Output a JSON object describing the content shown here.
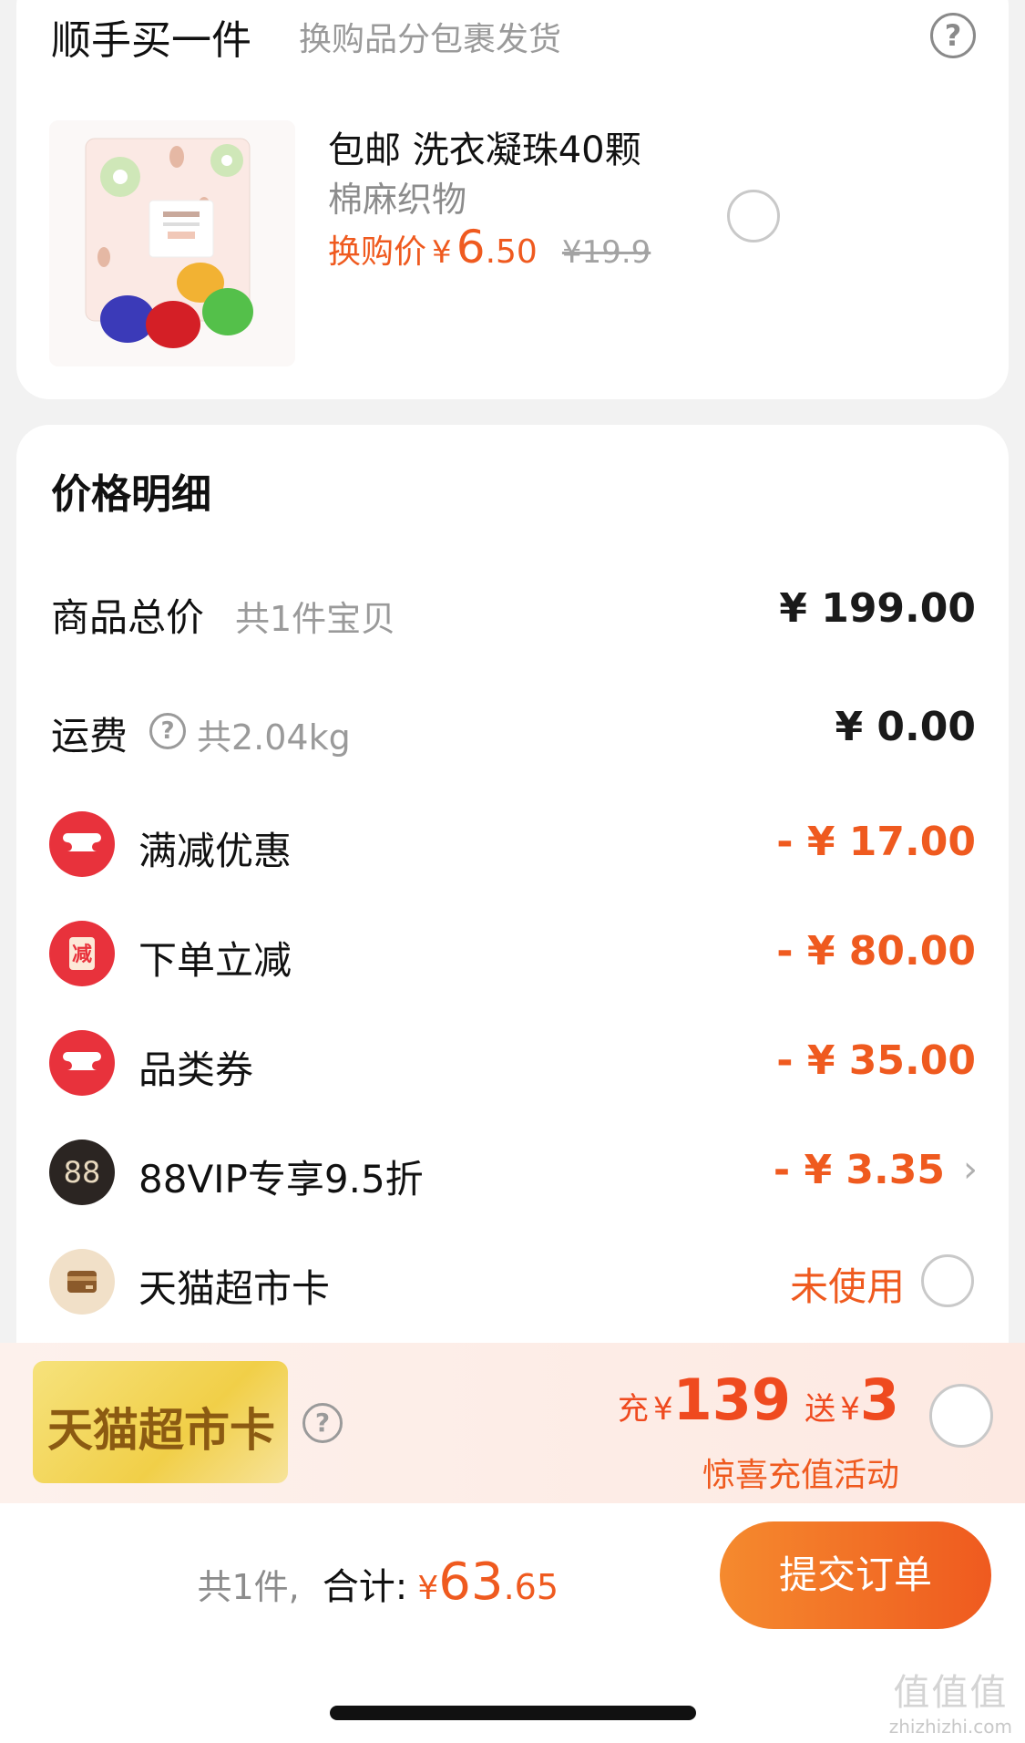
{
  "addon": {
    "title": "顺手买一件",
    "subtitle": "换购品分包裹发货",
    "help": "?",
    "product": {
      "name": "包邮 洗衣凝珠40颗",
      "spec": "棉麻织物",
      "price_label": "换购价",
      "currency": "¥",
      "price_int": "6",
      "price_dec": ".50",
      "original_price": "¥19.9"
    }
  },
  "detail": {
    "title": "价格明细",
    "goods_total": {
      "label": "商品总价",
      "note": "共1件宝贝",
      "amount": "¥ 199.00"
    },
    "shipping": {
      "label": "运费",
      "help": "?",
      "note": "共2.04kg",
      "amount": "¥ 0.00"
    },
    "discounts": [
      {
        "label": "满减优惠",
        "amount": "- ¥ 17.00",
        "icon": "ticket-icon"
      },
      {
        "label": "下单立减",
        "amount": "- ¥ 80.00",
        "icon": "reduce-icon",
        "icon_text": "减"
      },
      {
        "label": "品类券",
        "amount": "- ¥ 35.00",
        "icon": "ticket-icon"
      },
      {
        "label": "88VIP专享9.5折",
        "amount": "- ¥ 3.35",
        "icon": "vip88-icon",
        "icon_text": "88"
      }
    ],
    "market_card": {
      "label": "天猫超市卡",
      "status": "未使用",
      "icon": "wallet-card-icon"
    }
  },
  "banner": {
    "card_text": "天猫超市卡",
    "help": "?",
    "recharge_prefix": "充",
    "currency": "¥",
    "recharge_amount": "139",
    "gift_prefix": "送",
    "gift_amount": "3",
    "activity": "惊喜充值活动"
  },
  "footer": {
    "count": "共1件,",
    "total_label": "合计:",
    "currency": "¥",
    "total_int": "63",
    "total_dec": ".65",
    "submit": "提交订单"
  },
  "watermark": {
    "logo": "值值值",
    "text": "zhizhizhi.com"
  },
  "colors": {
    "accent": "#ef5a1f",
    "coupon_red": "#e8323c",
    "gold": "#f1cf48"
  }
}
